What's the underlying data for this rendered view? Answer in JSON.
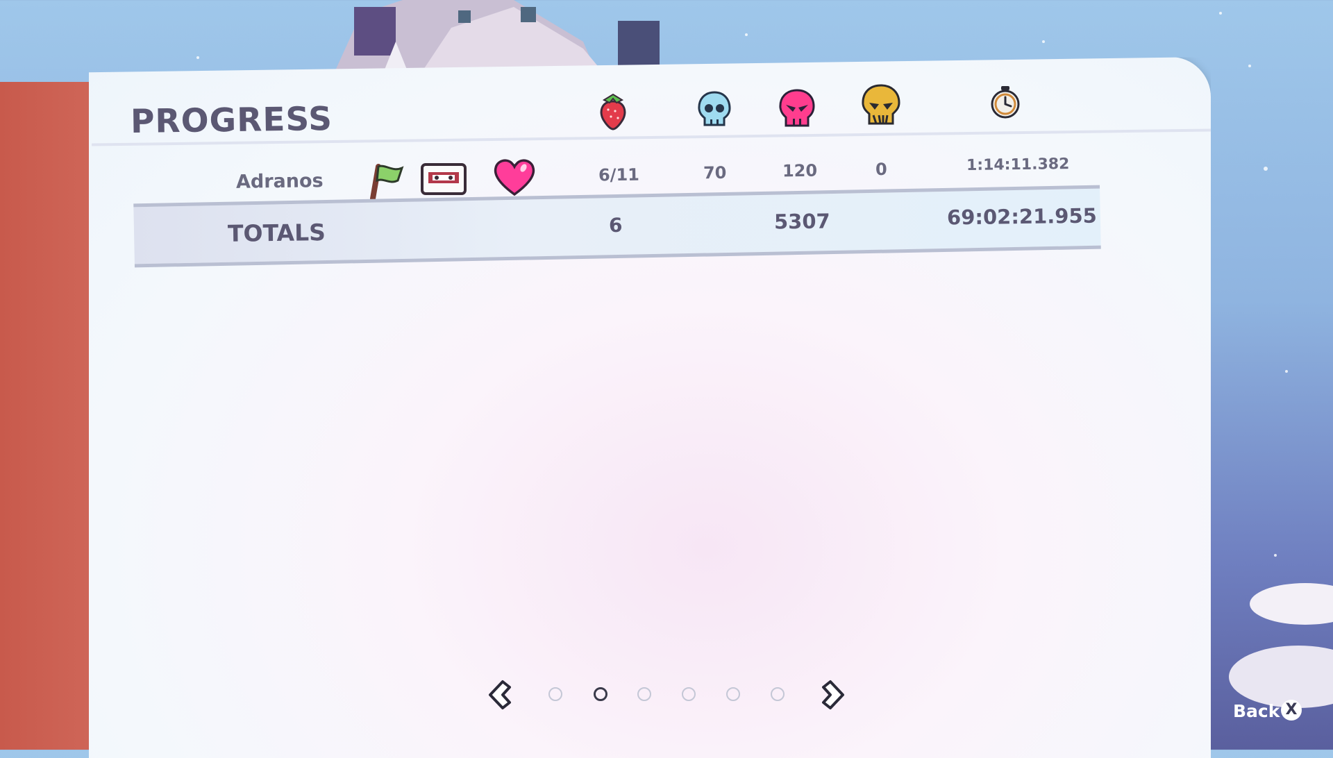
{
  "panel": {
    "title": "PROGRESS"
  },
  "columns": {
    "icons": [
      "strawberry-icon",
      "death-skull-blue-icon",
      "death-skull-pink-icon",
      "death-skull-gold-icon",
      "stopwatch-icon"
    ]
  },
  "row": {
    "name": "Adranos",
    "strawberries": "6/11",
    "deaths_a": "70",
    "deaths_b": "120",
    "deaths_c": "0",
    "time": "1:14:11.382",
    "icons": [
      "flag-icon",
      "cassette-icon",
      "heart-icon"
    ]
  },
  "totals": {
    "label": "TOTALS",
    "strawberries": "6",
    "deaths": "5307",
    "time": "69:02:21.955"
  },
  "pager": {
    "pages": 6,
    "current": 2
  },
  "footer": {
    "back_label": "Back",
    "back_key": "X"
  },
  "colors": {
    "accent_pink": "#ff3d9a",
    "slab": "#c85a4c",
    "text": "#5b5873"
  }
}
